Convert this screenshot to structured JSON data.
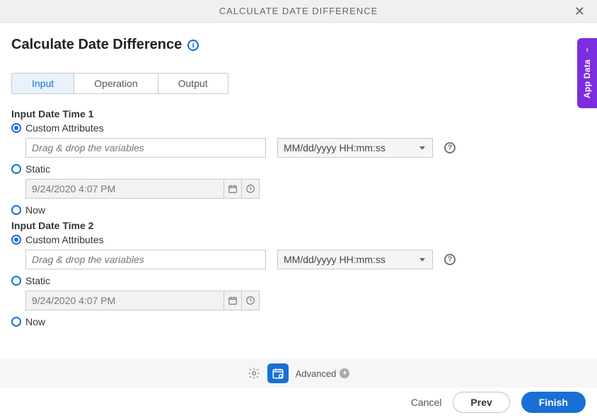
{
  "header": {
    "title": "CALCULATE DATE DIFFERENCE"
  },
  "page": {
    "title": "Calculate Date Difference"
  },
  "tabs": [
    "Input",
    "Operation",
    "Output"
  ],
  "sections": [
    {
      "title": "Input Date Time 1",
      "custom_label": "Custom Attributes",
      "drag_placeholder": "Drag & drop the variables",
      "format_value": "MM/dd/yyyy HH:mm:ss",
      "static_label": "Static",
      "static_value": "9/24/2020 4:07 PM",
      "now_label": "Now"
    },
    {
      "title": "Input Date Time 2",
      "custom_label": "Custom Attributes",
      "drag_placeholder": "Drag & drop the variables",
      "format_value": "MM/dd/yyyy HH:mm:ss",
      "static_label": "Static",
      "static_value": "9/24/2020 4:07 PM",
      "now_label": "Now"
    }
  ],
  "bottom": {
    "advanced_label": "Advanced"
  },
  "side_tab": {
    "label": "App Data"
  },
  "footer": {
    "cancel": "Cancel",
    "prev": "Prev",
    "finish": "Finish"
  }
}
